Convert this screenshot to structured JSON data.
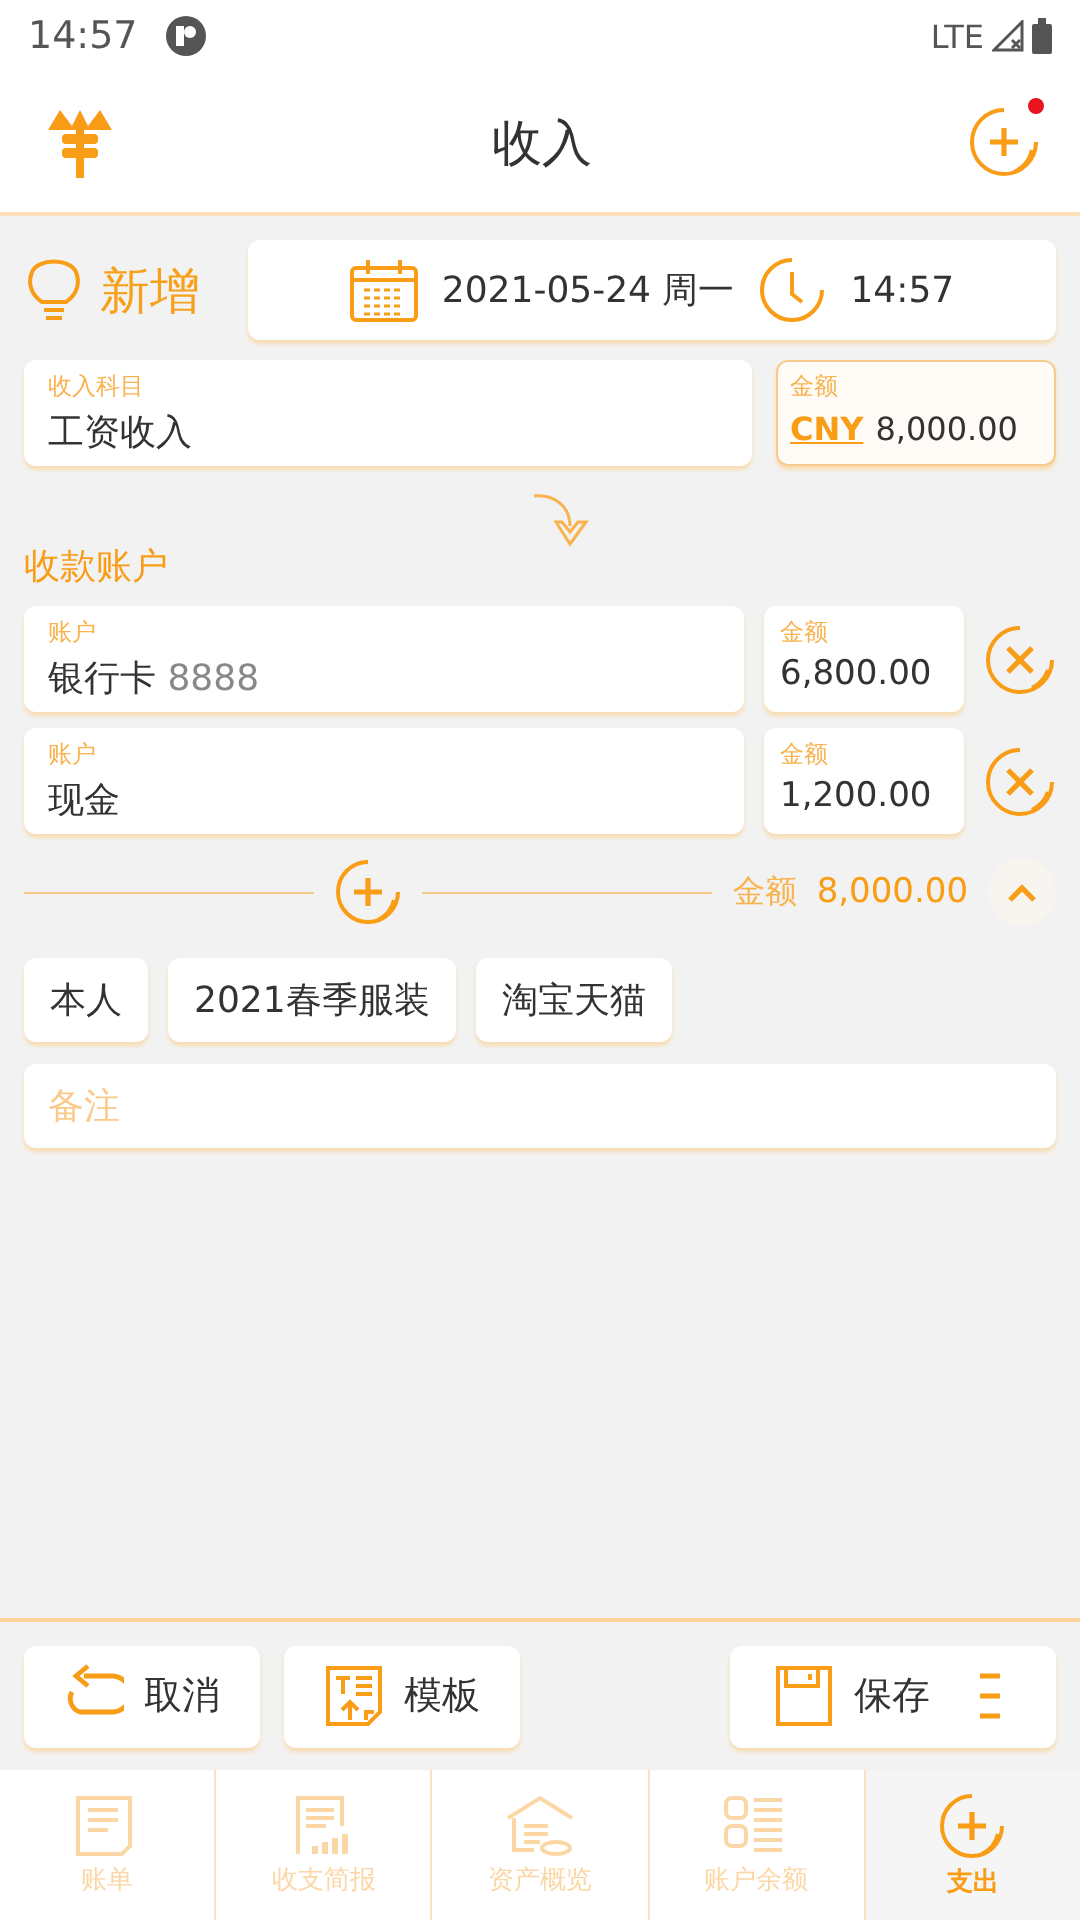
{
  "status_bar": {
    "time": "14:57",
    "network": "LTE"
  },
  "header": {
    "title": "收入",
    "has_notification": true
  },
  "entry": {
    "mode": "新增",
    "date": "2021-05-24 周一",
    "time": "14:57"
  },
  "category": {
    "label": "收入科目",
    "value": "工资收入"
  },
  "amount": {
    "label": "金额",
    "currency": "CNY",
    "value": "8,000.00"
  },
  "accounts_section": {
    "title": "收款账户"
  },
  "accounts": [
    {
      "label": "账户",
      "name": "银行卡",
      "number": "8888",
      "amount_label": "金额",
      "amount": "6,800.00"
    },
    {
      "label": "账户",
      "name": "现金",
      "amount_label": "金额",
      "amount": "1,200.00"
    }
  ],
  "total": {
    "label": "金额",
    "value": "8,000.00",
    "expanded": true
  },
  "tags": [
    "本人",
    "2021春季服装",
    "淘宝天猫"
  ],
  "note": {
    "placeholder": "备注"
  },
  "actions": [
    {
      "kind": "cancel",
      "label": "取消"
    },
    {
      "kind": "template",
      "label": "模板"
    },
    {
      "kind": "save",
      "label": "保存"
    }
  ],
  "tabs": [
    {
      "kind": "bill",
      "label": "账单",
      "selected": false
    },
    {
      "kind": "report",
      "label": "收支简报",
      "selected": false
    },
    {
      "kind": "assets",
      "label": "资产概览",
      "selected": false
    },
    {
      "kind": "balance",
      "label": "账户余额",
      "selected": false
    },
    {
      "kind": "plus",
      "label": "支出",
      "selected": true
    }
  ]
}
